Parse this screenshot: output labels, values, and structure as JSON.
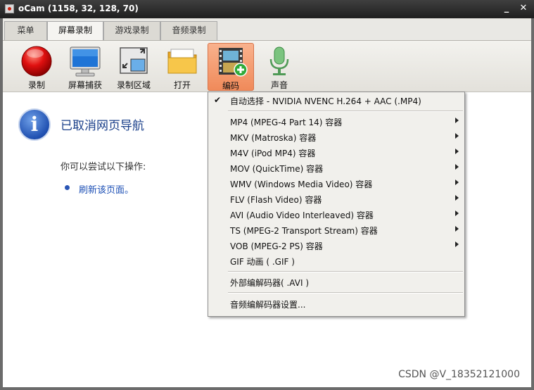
{
  "window": {
    "title": "oCam (1158, 32, 128, 70)"
  },
  "tabs": [
    {
      "label": "菜单"
    },
    {
      "label": "屏幕录制"
    },
    {
      "label": "游戏录制"
    },
    {
      "label": "音频录制"
    }
  ],
  "toolbar": {
    "record": "录制",
    "screenshot": "屏幕捕获",
    "region": "录制区域",
    "open": "打开",
    "codec": "编码",
    "sound": "声音"
  },
  "page": {
    "title": "已取消网页导航",
    "hint": "你可以尝试以下操作:",
    "refresh": "刷新该页面。"
  },
  "menu": {
    "items": [
      {
        "label": "自动选择 - NVIDIA NVENC H.264 + AAC (.MP4)"
      },
      {
        "label": "MP4 (MPEG-4 Part 14) 容器"
      },
      {
        "label": "MKV (Matroska) 容器"
      },
      {
        "label": "M4V (iPod MP4) 容器"
      },
      {
        "label": "MOV (QuickTime) 容器"
      },
      {
        "label": "WMV (Windows Media Video) 容器"
      },
      {
        "label": "FLV (Flash Video) 容器"
      },
      {
        "label": "AVI (Audio Video Interleaved) 容器"
      },
      {
        "label": "TS (MPEG-2 Transport Stream) 容器"
      },
      {
        "label": "VOB (MPEG-2 PS) 容器"
      },
      {
        "label": "GIF 动画 ( .GIF )"
      },
      {
        "label": "外部编解码器( .AVI )"
      },
      {
        "label": "音频编解码器设置..."
      }
    ]
  },
  "watermark": "CSDN @V_18352121000"
}
